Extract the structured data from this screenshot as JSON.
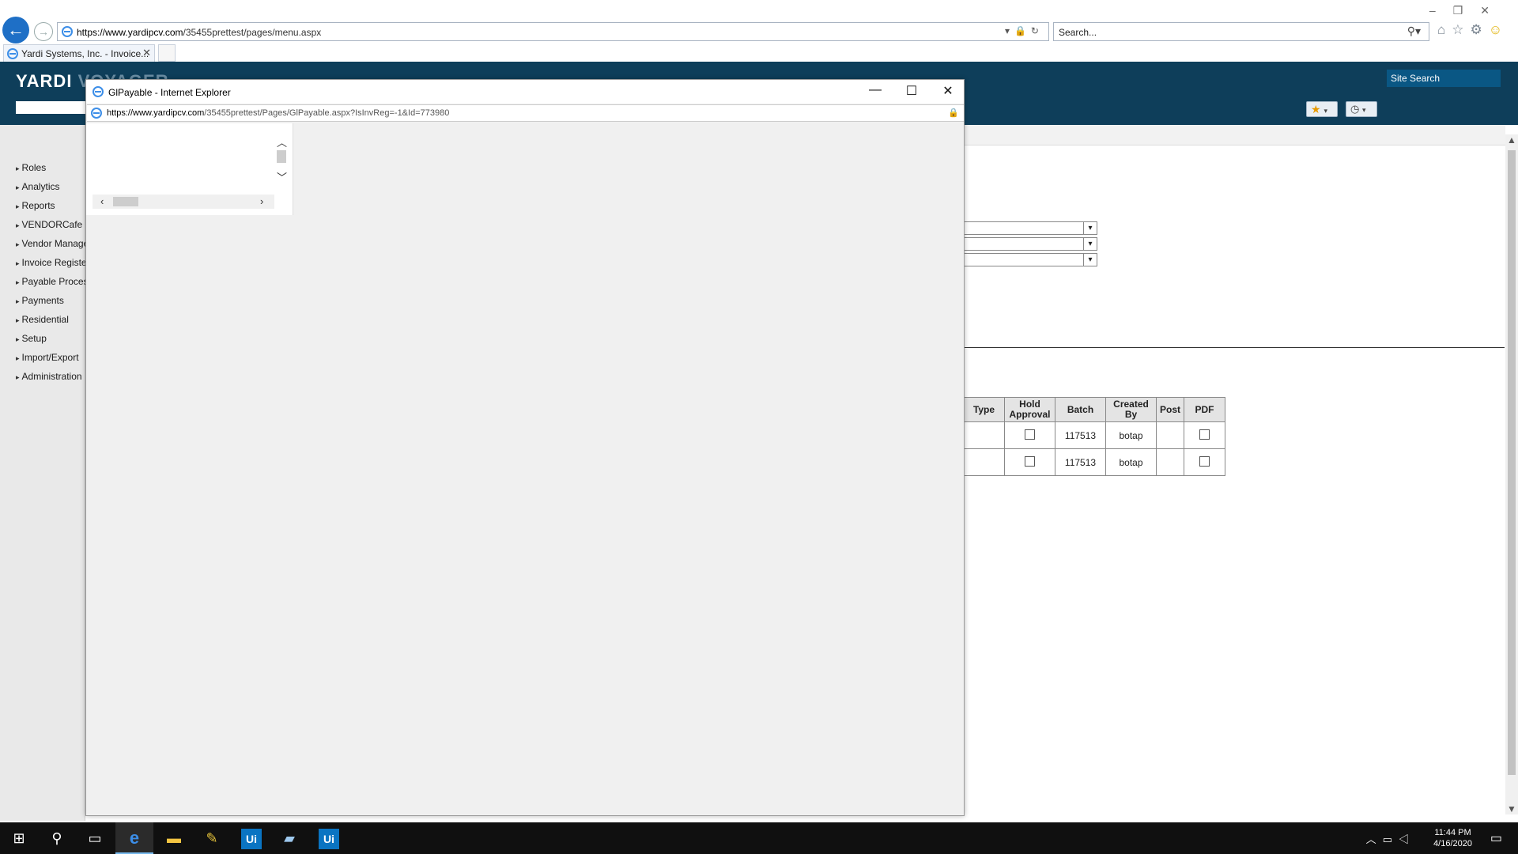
{
  "browser": {
    "url_domain": "https://www.yardipcv.com",
    "url_path": "/35455prettest/pages/menu.aspx",
    "search_placeholder": "Search...",
    "tab_title": "Yardi Systems, Inc. - Invoice...",
    "back_glyph": "←",
    "forward_glyph": "→"
  },
  "header": {
    "logo_a": "YARDI",
    "logo_b": "VOYAGER",
    "site_search": "Site Search",
    "colors": {
      "header_bg": "#0e3e5a",
      "accent": "#0a5784"
    }
  },
  "nav": {
    "items": [
      {
        "label": "Roles"
      },
      {
        "label": "Analytics"
      },
      {
        "label": "Reports"
      },
      {
        "label": "VENDORCafe"
      },
      {
        "label": "Vendor Management"
      },
      {
        "label": "Invoice Register"
      },
      {
        "label": "Payable Processing"
      },
      {
        "label": "Payments"
      },
      {
        "label": "Residential"
      },
      {
        "label": "Setup"
      },
      {
        "label": "Import/Export"
      },
      {
        "label": "Administration"
      }
    ]
  },
  "table": {
    "headers": {
      "type": "Type",
      "hold": "Hold Approval",
      "batch": "Batch",
      "created_by": "Created By",
      "post": "Post",
      "pdf": "PDF"
    },
    "rows": [
      {
        "type": "",
        "batch": "117513",
        "created_by": "botap",
        "post": ""
      },
      {
        "type": "",
        "batch": "117513",
        "created_by": "botap",
        "post": ""
      }
    ]
  },
  "popup": {
    "title": "GlPayable - Internet Explorer",
    "url_domain": "https://www.yardipcv.com",
    "url_path": "/35455prettest/Pages/GlPayable.aspx?IsInvReg=-1&Id=773980",
    "minimize_glyph": "—",
    "maximize_glyph": "☐",
    "close_glyph": "✕"
  },
  "taskbar": {
    "time": "11:44 PM",
    "date": "4/16/2020",
    "ui_label": "Ui"
  }
}
